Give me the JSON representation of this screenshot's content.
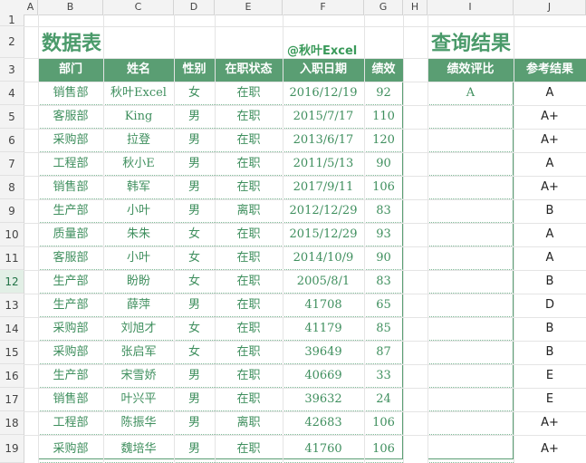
{
  "columns": [
    "A",
    "B",
    "C",
    "D",
    "E",
    "F",
    "G",
    "H",
    "I",
    "J"
  ],
  "rows": [
    "1",
    "2",
    "3",
    "4",
    "5",
    "6",
    "7",
    "8",
    "9",
    "10",
    "11",
    "12",
    "13",
    "14",
    "15",
    "16",
    "17",
    "18",
    "19"
  ],
  "selected_row": "12",
  "title_data": "数据表",
  "title_query": "查询结果",
  "credit": "@秋叶Excel",
  "data_headers": [
    "部门",
    "姓名",
    "性别",
    "在职状态",
    "入职日期",
    "绩效"
  ],
  "query_headers": [
    "绩效评比",
    "参考结果"
  ],
  "data_rows": [
    [
      "销售部",
      "秋叶Excel",
      "女",
      "在职",
      "2016/12/19",
      "92"
    ],
    [
      "客服部",
      "King",
      "男",
      "在职",
      "2015/7/17",
      "110"
    ],
    [
      "采购部",
      "拉登",
      "男",
      "在职",
      "2013/6/17",
      "120"
    ],
    [
      "工程部",
      "秋小E",
      "男",
      "在职",
      "2011/5/13",
      "90"
    ],
    [
      "销售部",
      "韩军",
      "男",
      "在职",
      "2017/9/11",
      "106"
    ],
    [
      "生产部",
      "小叶",
      "男",
      "离职",
      "2012/12/29",
      "83"
    ],
    [
      "质量部",
      "朱朱",
      "女",
      "在职",
      "2015/12/29",
      "93"
    ],
    [
      "客服部",
      "小叶",
      "女",
      "在职",
      "2014/10/9",
      "90"
    ],
    [
      "生产部",
      "盼盼",
      "女",
      "在职",
      "2005/8/1",
      "83"
    ],
    [
      "生产部",
      "薛萍",
      "男",
      "在职",
      "41708",
      "65"
    ],
    [
      "采购部",
      "刘旭才",
      "女",
      "在职",
      "41179",
      "85"
    ],
    [
      "采购部",
      "张启军",
      "女",
      "在职",
      "39649",
      "87"
    ],
    [
      "生产部",
      "宋雪娇",
      "男",
      "在职",
      "40669",
      "33"
    ],
    [
      "销售部",
      "叶兴平",
      "男",
      "在职",
      "39632",
      "24"
    ],
    [
      "工程部",
      "陈振华",
      "男",
      "离职",
      "42683",
      "106"
    ],
    [
      "采购部",
      "魏培华",
      "男",
      "在职",
      "41760",
      "106"
    ]
  ],
  "query_rows": [
    [
      "A",
      "A"
    ],
    [
      "",
      "A+"
    ],
    [
      "",
      "A+"
    ],
    [
      "",
      "A"
    ],
    [
      "",
      "A+"
    ],
    [
      "",
      "B"
    ],
    [
      "",
      "A"
    ],
    [
      "",
      "A"
    ],
    [
      "",
      "B"
    ],
    [
      "",
      "D"
    ],
    [
      "",
      "B"
    ],
    [
      "",
      "B"
    ],
    [
      "",
      "E"
    ],
    [
      "",
      "E"
    ],
    [
      "",
      "A+"
    ],
    [
      "",
      "A+"
    ]
  ]
}
